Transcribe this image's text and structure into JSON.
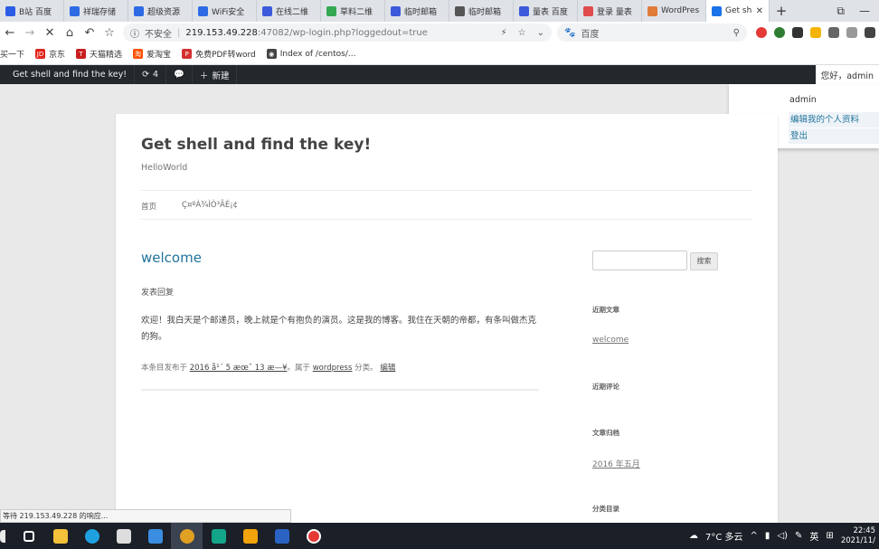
{
  "browser": {
    "tabs": [
      {
        "label": "B站 百度",
        "color": "#2b5ce6"
      },
      {
        "label": "祥瑞存储",
        "color": "#2d6be4"
      },
      {
        "label": "超级资源",
        "color": "#2d6be4"
      },
      {
        "label": "WiFi安全",
        "color": "#2d6be4"
      },
      {
        "label": "在线二维",
        "color": "#3b5bdb"
      },
      {
        "label": "草料二维",
        "color": "#34a853"
      },
      {
        "label": "临时邮箱",
        "color": "#3b5bdb"
      },
      {
        "label": "临时邮箱",
        "color": "#555555"
      },
      {
        "label": "量表 百度",
        "color": "#3b5bdb"
      },
      {
        "label": "登录 量表",
        "color": "#e04b4b"
      },
      {
        "label": "WordPres",
        "color": "#e07b39"
      },
      {
        "label": "Get sh",
        "color": "#1a73e8"
      }
    ],
    "new_tab": "+",
    "url_insecure": "不安全",
    "url_host": "219.153.49.228",
    "url_path": ":47082/wp-login.php?loggedout=true",
    "search_engine": "百度",
    "bookmarks": [
      {
        "label": "买一下",
        "color": "#c81e1e",
        "icon": ""
      },
      {
        "label": "京东",
        "color": "#e1251b",
        "icon": "JD"
      },
      {
        "label": "天猫精选",
        "color": "#c81e1e",
        "icon": "T"
      },
      {
        "label": "爱淘宝",
        "color": "#ff5000",
        "icon": "淘"
      },
      {
        "label": "免费PDF转word",
        "color": "#d32f2f",
        "icon": "P"
      },
      {
        "label": "Index of /centos/...",
        "color": "#444444",
        "icon": "◉"
      }
    ]
  },
  "adminbar": {
    "site_name": "Get shell and find the key!",
    "updates_count": "4",
    "new_label": "新建",
    "greeting": "您好，admin"
  },
  "account_menu": {
    "name": "admin",
    "edit_profile": "编辑我的个人资料",
    "logout": "登出"
  },
  "site": {
    "title": "Get shell and find the key!",
    "tagline": "HelloWorld",
    "menu": [
      "首页",
      "Ç¤ºÀ¾ÌÒ³ÃÈ¡¢"
    ]
  },
  "post": {
    "title": "welcome",
    "comment_link": "发表回复",
    "body": "欢迎！我白天是个邮递员，晚上就是个有抱负的演员。这是我的博客。我住在天朝的帝都，有条叫做杰克的狗。",
    "meta_prefix": "本条目发布于",
    "meta_date": "2016 å¹´ 5 æœˆ 13 æ—¥",
    "meta_mid": "。属于",
    "meta_category": "wordpress",
    "meta_suffix": "分类。",
    "meta_edit": "编辑"
  },
  "sidebar": {
    "search_button": "搜索",
    "recent_posts_heading": "近期文章",
    "recent_post": "welcome",
    "recent_comments_heading": "近期评论",
    "archives_heading": "文章归档",
    "archive_item": "2016 年五月",
    "categories_heading": "分类目录"
  },
  "status_text": "等待 219.153.49.228 的响应...",
  "taskbar": {
    "weather": "7°C 多云",
    "ime": "英",
    "time": "22:45",
    "date": "2021/11/"
  }
}
